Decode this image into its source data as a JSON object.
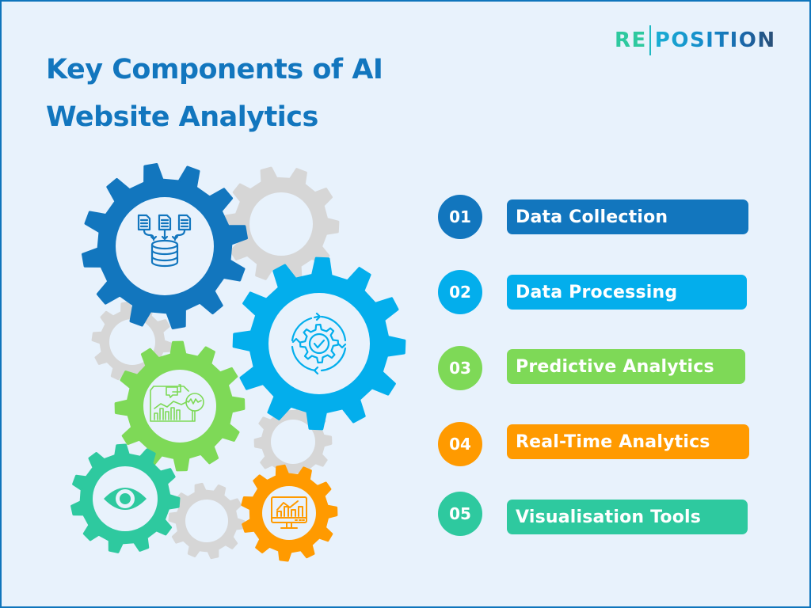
{
  "title_lines": [
    "Key Components of AI",
    "Website Analytics"
  ],
  "logo": {
    "part1": "RE",
    "part2": "POSITION"
  },
  "colors": {
    "background": "#e8f2fc",
    "title": "#1276be",
    "gray_gear": "#d6d6d6",
    "icon_bg": "#e8f2fc"
  },
  "components": [
    {
      "number": "01",
      "label": "Data Collection",
      "color": "#1276be",
      "icon": "documents-to-database-icon"
    },
    {
      "number": "02",
      "label": "Data Processing",
      "color": "#03aeec",
      "icon": "gear-check-cycle-icon"
    },
    {
      "number": "03",
      "label": "Predictive Analytics",
      "color": "#7ed957",
      "icon": "report-magnifier-chart-icon"
    },
    {
      "number": "04",
      "label": "Real-Time Analytics",
      "color": "#ff9a00",
      "icon": "monitor-chart-icon"
    },
    {
      "number": "05",
      "label": "Visualisation Tools",
      "color": "#2ec99f",
      "icon": "eye-icon"
    }
  ]
}
